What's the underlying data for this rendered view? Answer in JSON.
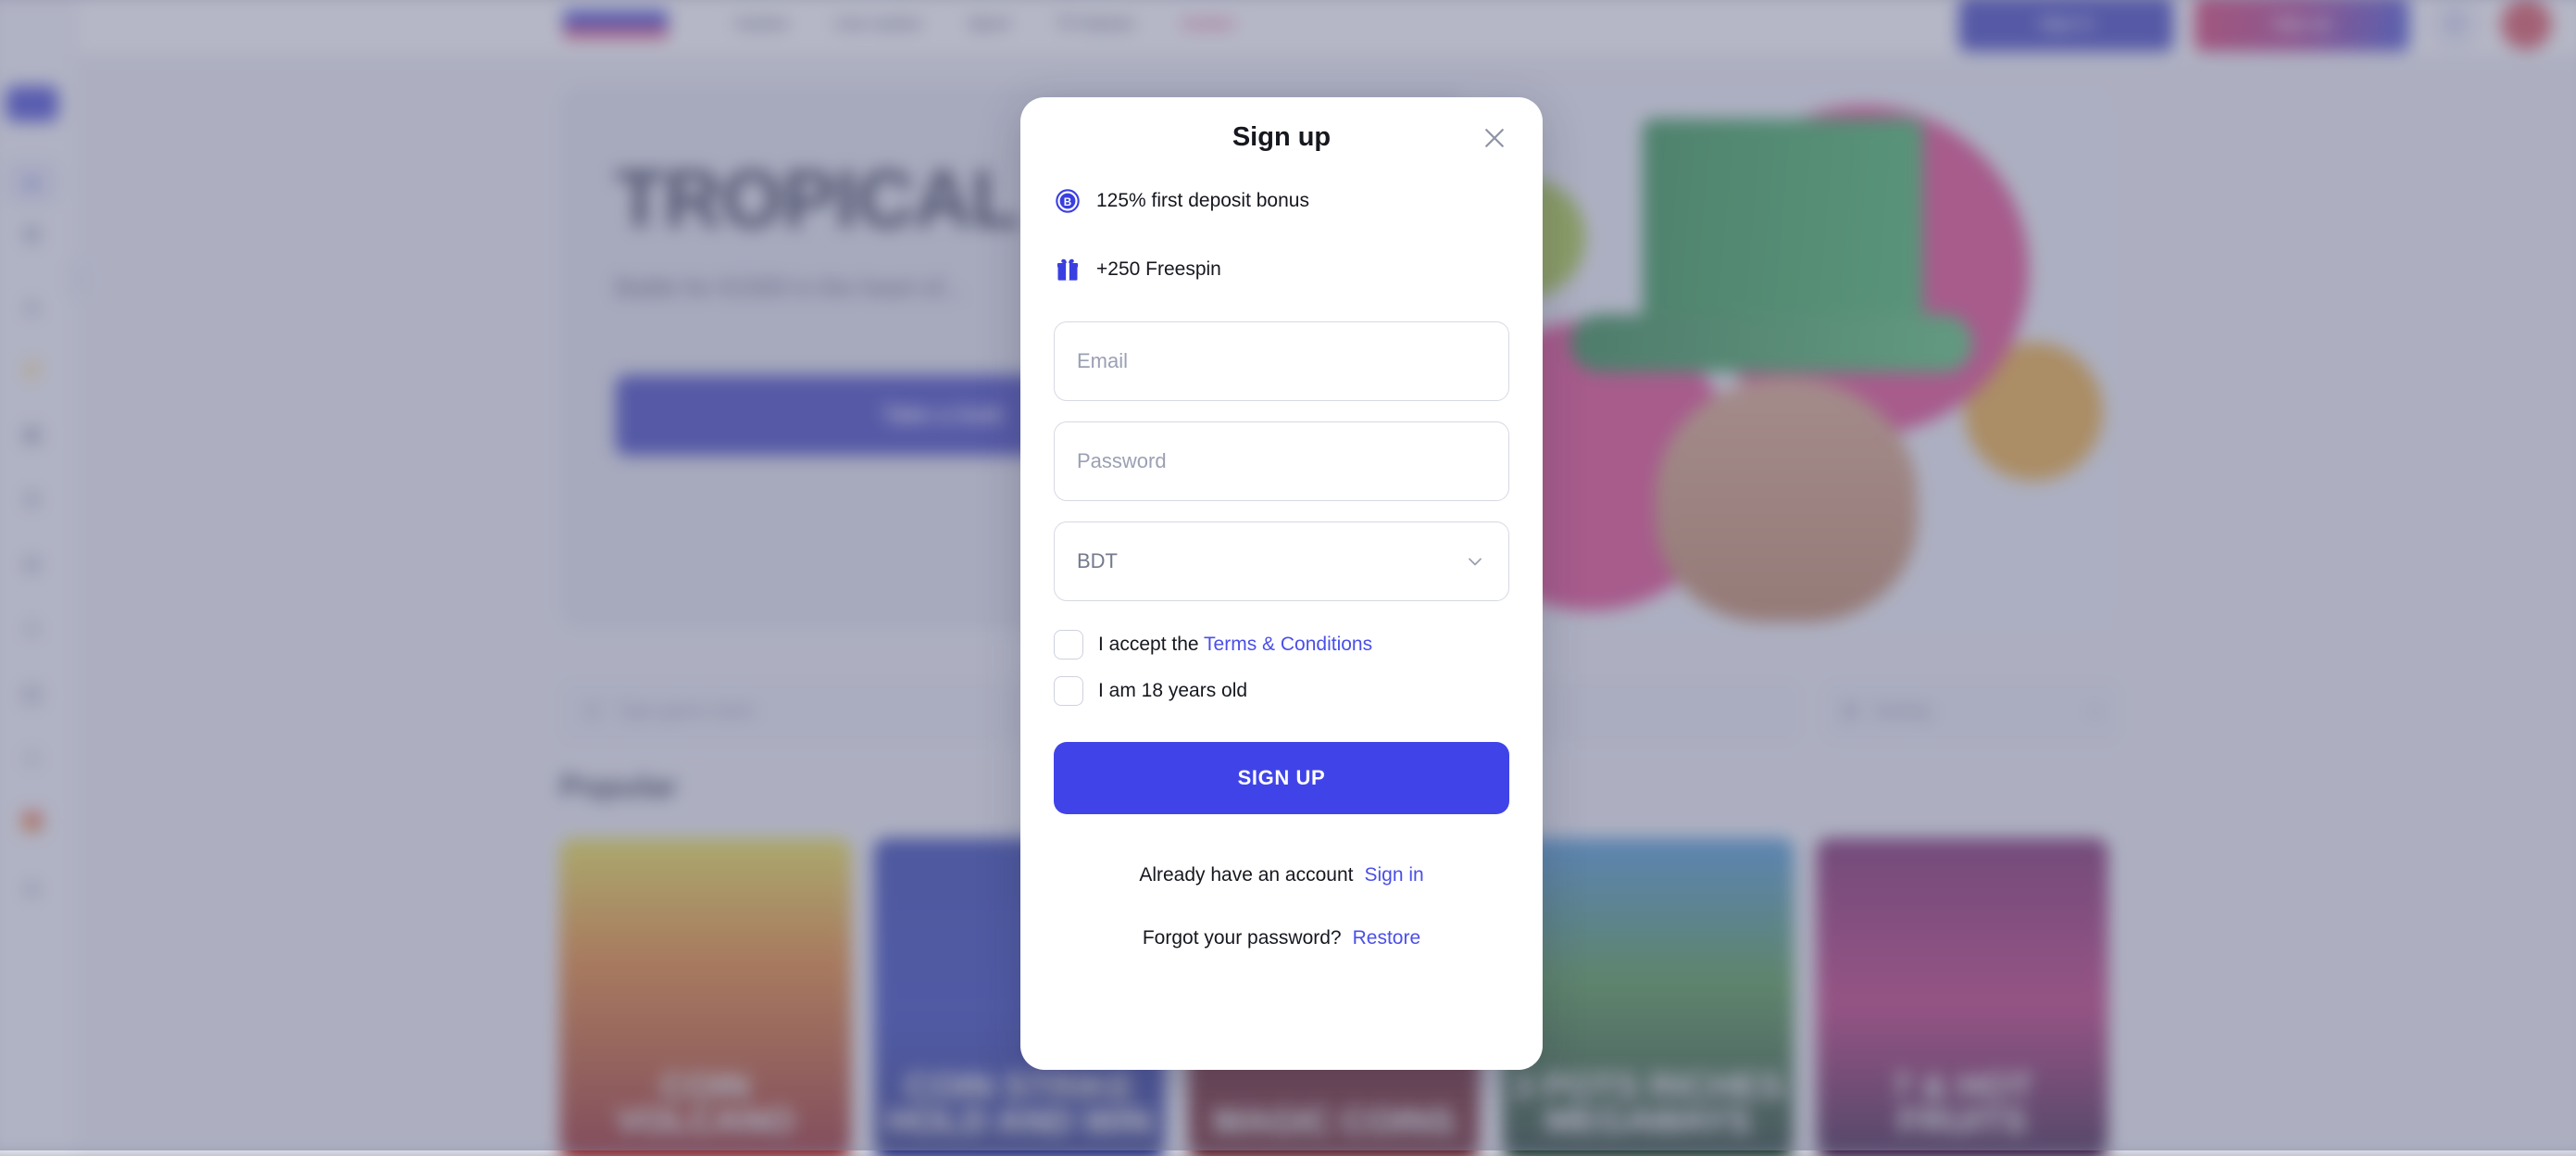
{
  "background": {
    "sidebar": {
      "logo_icon": "brand-logo-icon",
      "items": [
        {
          "icon": "home-icon",
          "name": "home",
          "active": true
        },
        {
          "icon": "casino-chip-icon",
          "name": "casino",
          "active": false
        },
        {
          "icon": "rocket-icon",
          "name": "crash",
          "active": false
        },
        {
          "icon": "bolt-icon",
          "name": "fast-games",
          "active": false
        },
        {
          "icon": "ticket-icon",
          "name": "lottery",
          "active": false
        },
        {
          "icon": "clover-icon",
          "name": "jackpot",
          "active": false
        },
        {
          "icon": "dice-icon",
          "name": "table-games",
          "active": false
        },
        {
          "icon": "cards-icon",
          "name": "poker",
          "active": false
        },
        {
          "icon": "tv-icon",
          "name": "live-casino",
          "active": false
        },
        {
          "icon": "trophy-icon",
          "name": "tournaments",
          "active": false
        },
        {
          "icon": "gift-icon",
          "name": "bonuses",
          "active": false
        },
        {
          "icon": "chart-icon",
          "name": "statistics",
          "active": false
        }
      ],
      "collapse_toggle_icon": "chevron-right-icon"
    },
    "topnav": {
      "logo": "brand-logo",
      "links": [
        {
          "label": "Casino"
        },
        {
          "label": "Live casino"
        },
        {
          "label": "Sport"
        },
        {
          "label": "TV Games"
        },
        {
          "label": "Aviator",
          "hot": true
        }
      ],
      "sign_in_label": "Sign in",
      "sign_up_label": "Sign up",
      "search_icon": "search-icon",
      "flag_icon": "language-flag-icon"
    },
    "hero": {
      "title": "TROPICAL",
      "subtitle": "Battle for €1500 in the heart of...",
      "cta_label": "Take a look"
    },
    "search": {
      "placeholder": "Type game name",
      "icon": "search-icon"
    },
    "sorting": {
      "icon": "sort-icon",
      "label": "Sorting",
      "chevron": "chevron-down-icon"
    },
    "popular": {
      "heading": "Popular",
      "cards": [
        {
          "title": "COIN VOLCANO",
          "class": "c1"
        },
        {
          "title": "COIN STRIKE HOLD AND WIN",
          "class": "c2"
        },
        {
          "title": "MAGIC COINS",
          "class": "c3"
        },
        {
          "title": "3 POTS RICHES MEGAWAYS",
          "class": "c4"
        },
        {
          "title": "7 & HOT FRUITS",
          "class": "c5"
        }
      ]
    }
  },
  "modal": {
    "title": "Sign up",
    "close_icon": "close-icon",
    "bonuses": [
      {
        "icon": "bonus-badge-icon",
        "text": "125% first deposit bonus"
      },
      {
        "icon": "gift-icon",
        "text": "+250 Freespin"
      }
    ],
    "fields": {
      "email": {
        "placeholder": "Email",
        "value": ""
      },
      "password": {
        "placeholder": "Password",
        "value": ""
      },
      "currency": {
        "value": "BDT",
        "chevron": "chevron-down-icon"
      }
    },
    "checkboxes": [
      {
        "prefix": "I accept the",
        "link": "Terms & Conditions",
        "checked": false,
        "name": "terms"
      },
      {
        "prefix": "I am 18 years old",
        "link": "",
        "checked": false,
        "name": "age"
      }
    ],
    "submit_label": "SIGN UP",
    "footer": {
      "have_account_text": "Already have an account",
      "sign_in_link": "Sign in",
      "forgot_text": "Forgot your password?",
      "restore_link": "Restore"
    }
  },
  "colors": {
    "accent_blue": "#4044e8",
    "link_blue": "#4a4fe8",
    "overlay": "#787c98",
    "modal_bg": "#ffffff",
    "brand_blue": "#3538cd",
    "hot_pink": "#e03a6d"
  }
}
